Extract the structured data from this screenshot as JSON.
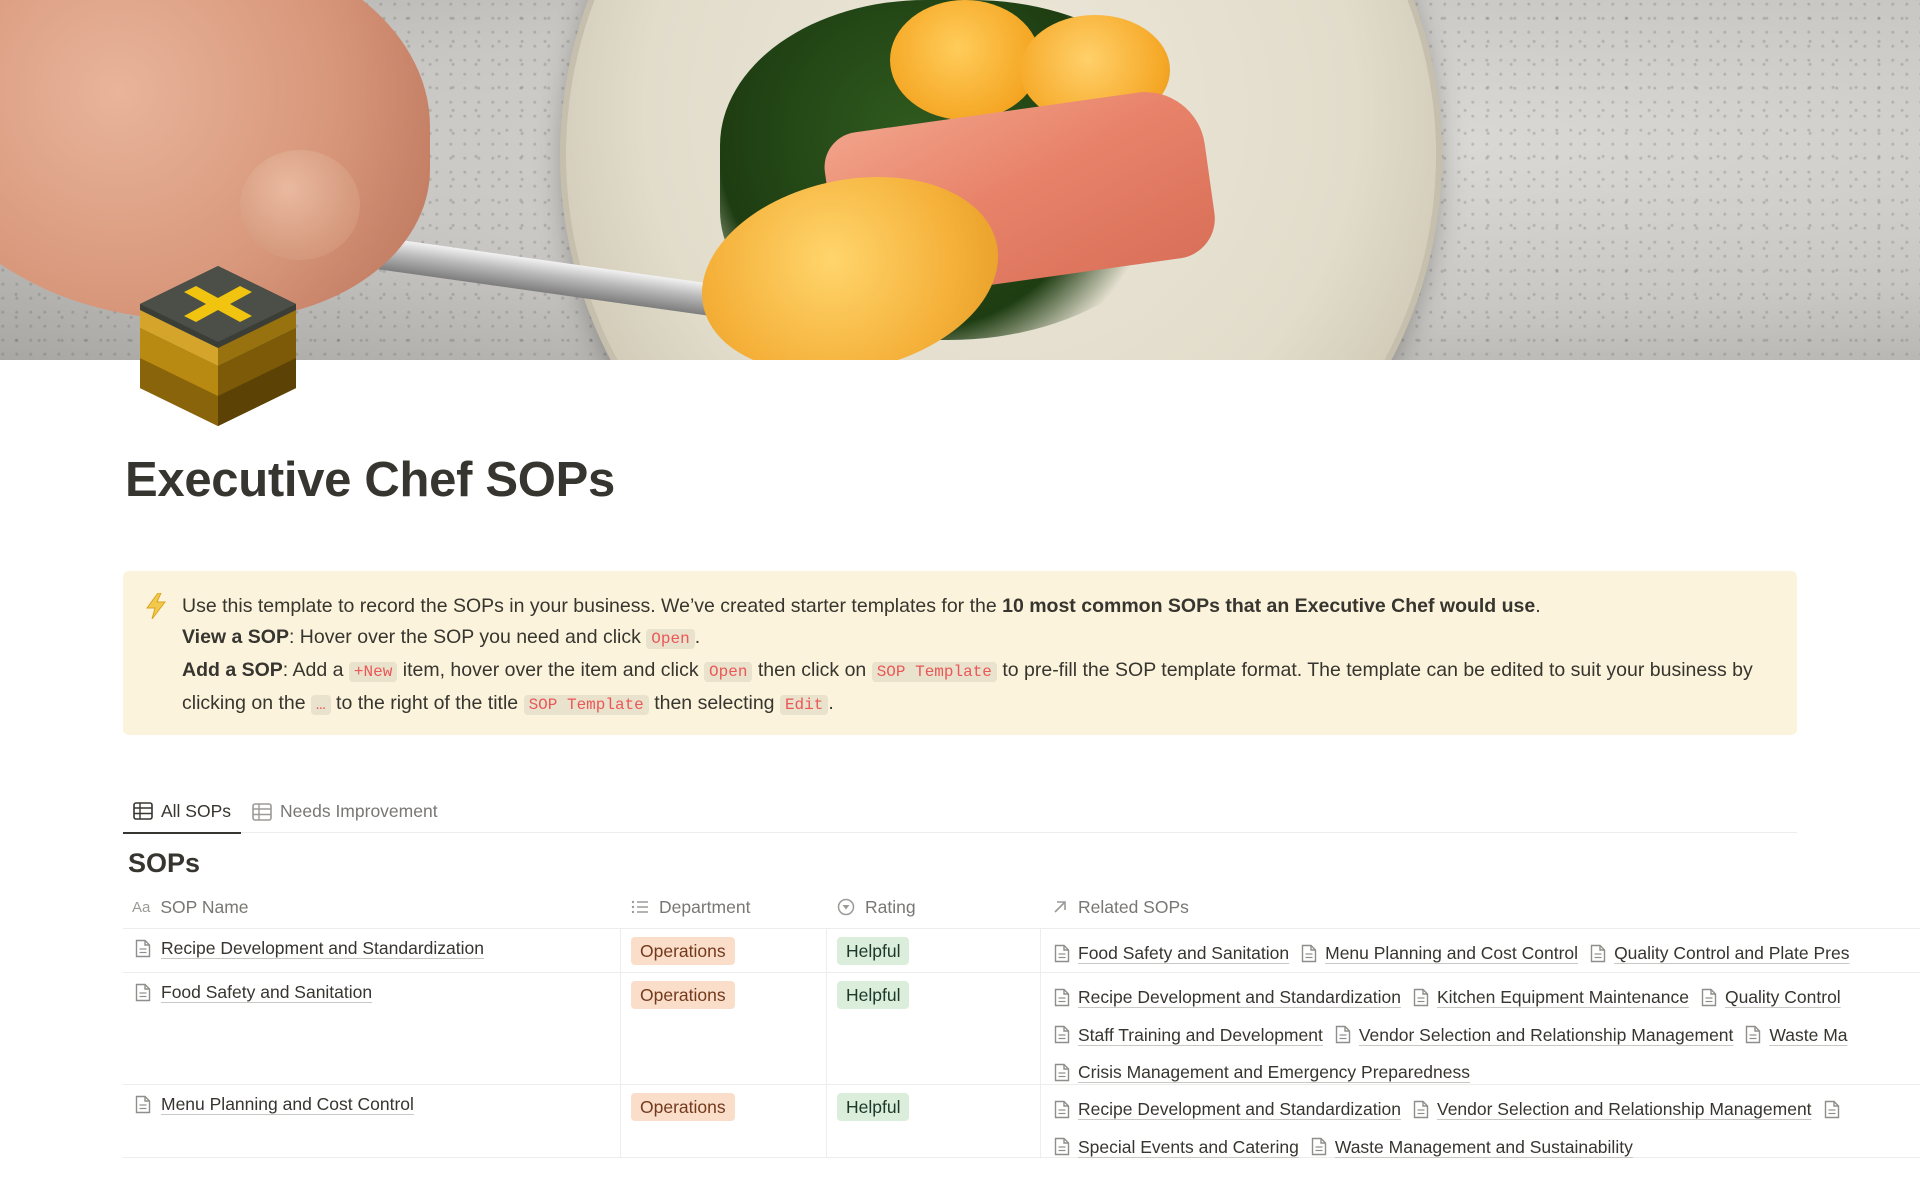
{
  "page": {
    "title": "Executive Chef SOPs",
    "icon": "cube-with-x-icon"
  },
  "callout": {
    "icon": "lightning-bolt-icon",
    "line1": {
      "text": "Use this template to record the SOPs in your business. We’ve created starter templates for the ",
      "bold": "10 most common SOPs that an Executive Chef would use",
      "end": "."
    },
    "line2": {
      "bold": "View a SOP",
      "text": ": Hover over the SOP you need and click ",
      "code": "Open",
      "end": "."
    },
    "line3": {
      "bold": "Add a SOP",
      "t1": ": Add a ",
      "c1": "+New",
      "t2": " item, hover over the item and click ",
      "c2": "Open",
      "t3": " then click on ",
      "c3": "SOP Template",
      "t4": " to pre-fill the SOP template format. The template can be edited to suit your business by clicking on the ",
      "c4": "…",
      "t5": " to the right of the title ",
      "c5": "SOP Template",
      "t6": " then selecting ",
      "c6": "Edit",
      "end": "."
    }
  },
  "tabs": [
    {
      "label": "All SOPs",
      "icon": "table-icon",
      "active": true
    },
    {
      "label": "Needs Improvement",
      "icon": "table-icon",
      "active": false
    }
  ],
  "database": {
    "title": "SOPs",
    "columns": [
      {
        "label": "SOP Name",
        "icon": "Aa"
      },
      {
        "label": "Department",
        "icon": "list-icon"
      },
      {
        "label": "Rating",
        "icon": "select-icon"
      },
      {
        "label": "Related SOPs",
        "icon": "arrow-up-right-icon"
      }
    ],
    "rows": [
      {
        "name": "Recipe Development and Standardization",
        "department": "Operations",
        "rating": "Helpful",
        "related": [
          "Food Safety and Sanitation",
          "Menu Planning and Cost Control",
          "Quality Control and Plate Pres"
        ]
      },
      {
        "name": "Food Safety and Sanitation",
        "department": "Operations",
        "rating": "Helpful",
        "related": [
          "Recipe Development and Standardization",
          "Kitchen Equipment Maintenance",
          "Quality Control",
          "Staff Training and Development",
          "Vendor Selection and Relationship Management",
          "Waste Ma",
          "Crisis Management and Emergency Preparedness"
        ]
      },
      {
        "name": "Menu Planning and Cost Control",
        "department": "Operations",
        "rating": "Helpful",
        "related": [
          "Recipe Development and Standardization",
          "Vendor Selection and Relationship Management",
          "",
          "Special Events and Catering",
          "Waste Management and Sustainability"
        ]
      }
    ]
  },
  "colors": {
    "callout_bg": "#fbf3db",
    "code_text": "#eb5757",
    "dept_tag_bg": "#fadec9",
    "rating_tag_bg": "#dbeddb"
  }
}
